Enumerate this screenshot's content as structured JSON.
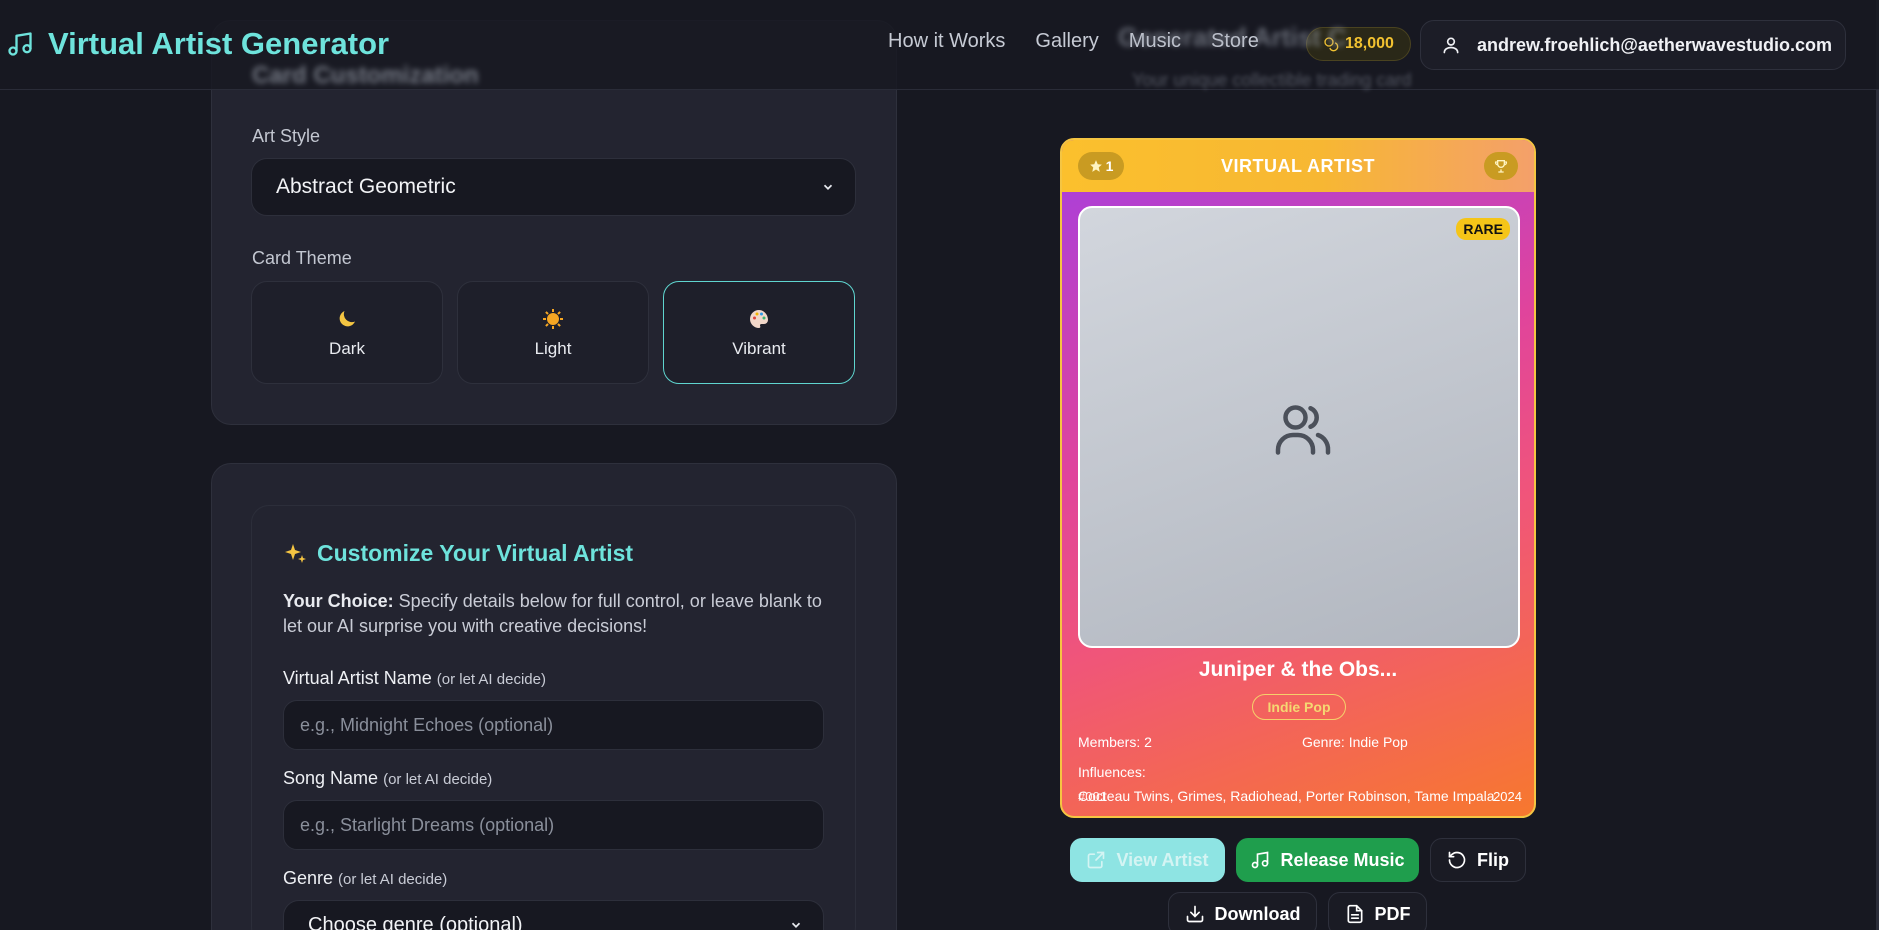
{
  "header": {
    "app_title": "Virtual Artist Generator",
    "nav": [
      "How it Works",
      "Gallery",
      "Music",
      "Store"
    ],
    "coins": "18,000",
    "user_email": "andrew.froehlich@aetherwavestudio.com"
  },
  "behind": {
    "panel_title": "Card Customization",
    "right_title": "Generated Artist C",
    "right_subtitle": "Your unique collectible trading card"
  },
  "customization": {
    "art_style_label": "Art Style",
    "art_style_value": "Abstract Geometric",
    "card_theme_label": "Card Theme",
    "themes": [
      {
        "label": "Dark",
        "icon": "moon-icon"
      },
      {
        "label": "Light",
        "icon": "sun-icon"
      },
      {
        "label": "Vibrant",
        "icon": "palette-icon"
      }
    ],
    "selected_theme": "Vibrant"
  },
  "custom_artist": {
    "title": "Customize Your Virtual Artist",
    "desc_bold": "Your Choice:",
    "desc_text": " Specify details below for full control, or leave blank to let our AI surprise you with creative decisions!",
    "fields": [
      {
        "label": "Virtual Artist Name",
        "hint": "(or let AI decide)",
        "placeholder": "e.g., Midnight Echoes (optional)"
      },
      {
        "label": "Song Name",
        "hint": "(or let AI decide)",
        "placeholder": "e.g., Starlight Dreams (optional)"
      },
      {
        "label": "Genre",
        "hint": "(or let AI decide)",
        "placeholder": "Choose genre (optional)"
      }
    ]
  },
  "card": {
    "stars": "1",
    "title": "VIRTUAL ARTIST",
    "rarity": "RARE",
    "artist_name": "Juniper & the Obs...",
    "genre_pill": "Indie Pop",
    "members": "Members: 2",
    "genre": "Genre: Indie Pop",
    "influences_label": "Influences:",
    "influences": "Cocteau Twins, Grimes, Radiohead, Porter Robinson, Tame Impala",
    "number": "#001",
    "year": "2024"
  },
  "actions": {
    "view_artist": "View Artist",
    "release_music": "Release Music",
    "flip": "Flip",
    "download": "Download",
    "pdf": "PDF"
  },
  "colors": {
    "accent": "#6ee3dc",
    "gold": "#f5c542",
    "release_green": "#1f9e4d",
    "background": "#171821",
    "panel": "#232430"
  }
}
